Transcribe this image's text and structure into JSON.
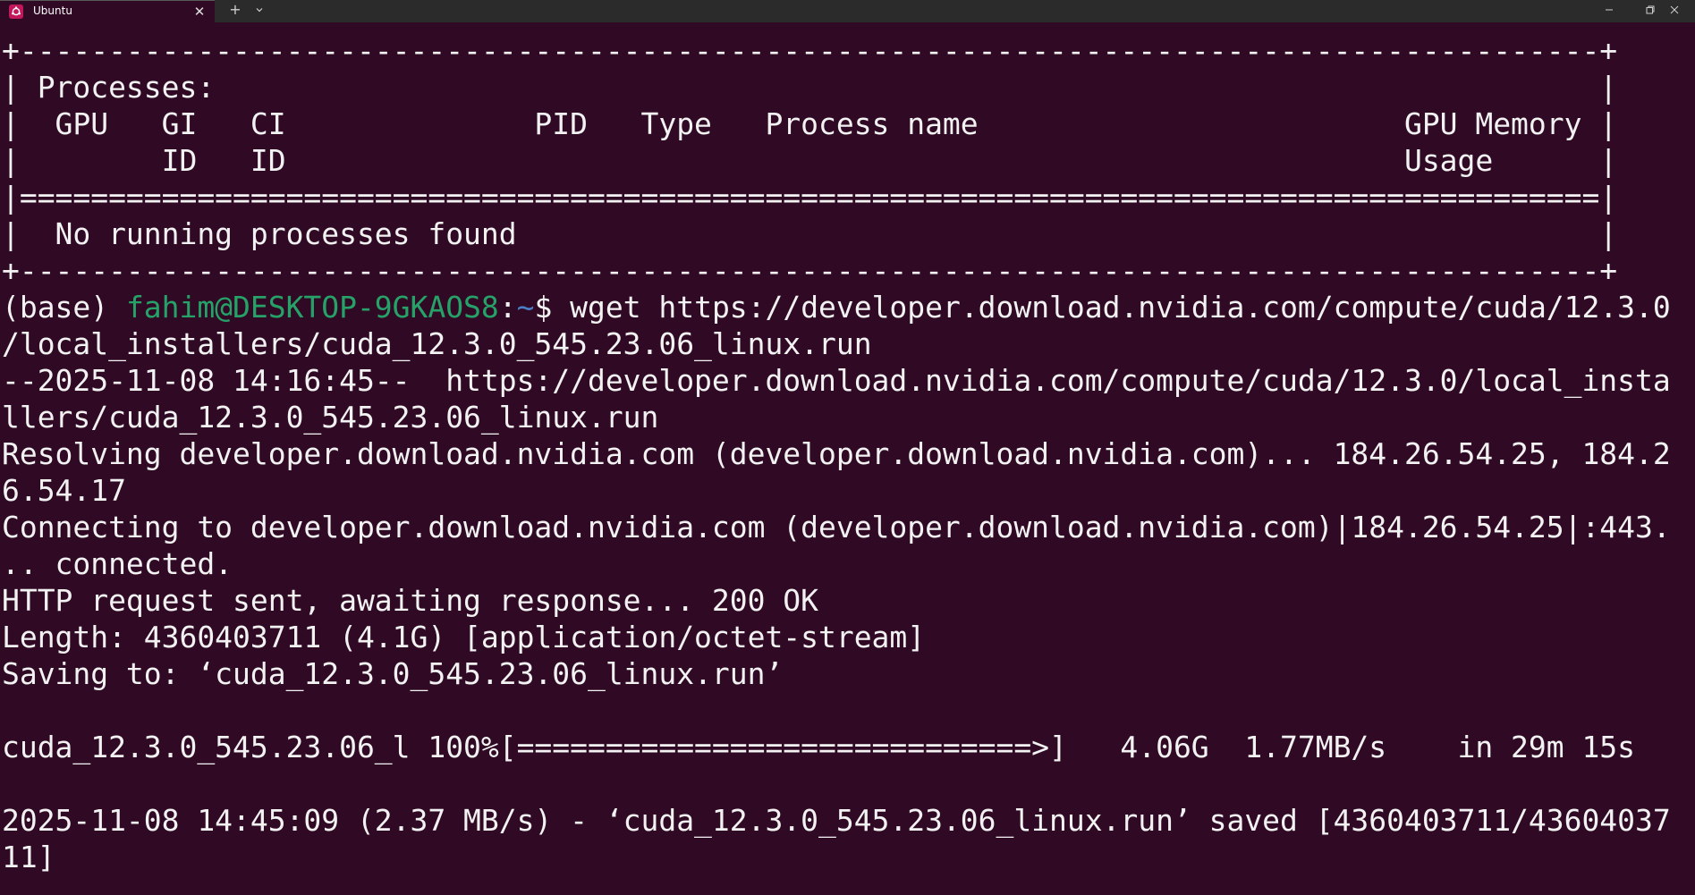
{
  "window": {
    "tab_title": "Ubuntu",
    "tab_close_glyph": "✕",
    "new_tab_glyph": "+",
    "tab_menu_glyph": "⌄"
  },
  "terminal": {
    "colors": {
      "background": "#300a24",
      "foreground": "#f2f2f2",
      "prompt_user": "#26a269",
      "prompt_path": "#4a7fc4"
    },
    "table": {
      "border_top": "+-----------------------------------------------------------------------------------------+",
      "header_1": "| Processes:                                                                              |",
      "header_2": "|  GPU   GI   CI              PID   Type   Process name                        GPU Memory |",
      "header_3": "|        ID   ID                                                               Usage      |",
      "separator": "|=========================================================================================|",
      "row_1": "|  No running processes found                                                             |",
      "border_bottom": "+-----------------------------------------------------------------------------------------+"
    },
    "prompt": {
      "env": "(base) ",
      "user_host": "fahim@DESKTOP-9GKAOS8",
      "colon": ":",
      "path": "~",
      "symbol": "$ ",
      "command_part1": "wget https://developer.download.nvidia.com/compute/cuda/12.3.0",
      "command_part2": "/local_installers/cuda_12.3.0_545.23.06_linux.run"
    },
    "output": [
      "--2025-11-08 14:16:45--  https://developer.download.nvidia.com/compute/cuda/12.3.0/local_insta",
      "llers/cuda_12.3.0_545.23.06_linux.run",
      "Resolving developer.download.nvidia.com (developer.download.nvidia.com)... 184.26.54.25, 184.2",
      "6.54.17",
      "Connecting to developer.download.nvidia.com (developer.download.nvidia.com)|184.26.54.25|:443.",
      ".. connected.",
      "HTTP request sent, awaiting response... 200 OK",
      "Length: 4360403711 (4.1G) [application/octet-stream]",
      "Saving to: ‘cuda_12.3.0_545.23.06_linux.run’",
      "",
      "cuda_12.3.0_545.23.06_l 100%[=============================>]   4.06G  1.77MB/s    in 29m 15s",
      "",
      "2025-11-08 14:45:09 (2.37 MB/s) - ‘cuda_12.3.0_545.23.06_linux.run’ saved [4360403711/43604037",
      "11]"
    ]
  }
}
